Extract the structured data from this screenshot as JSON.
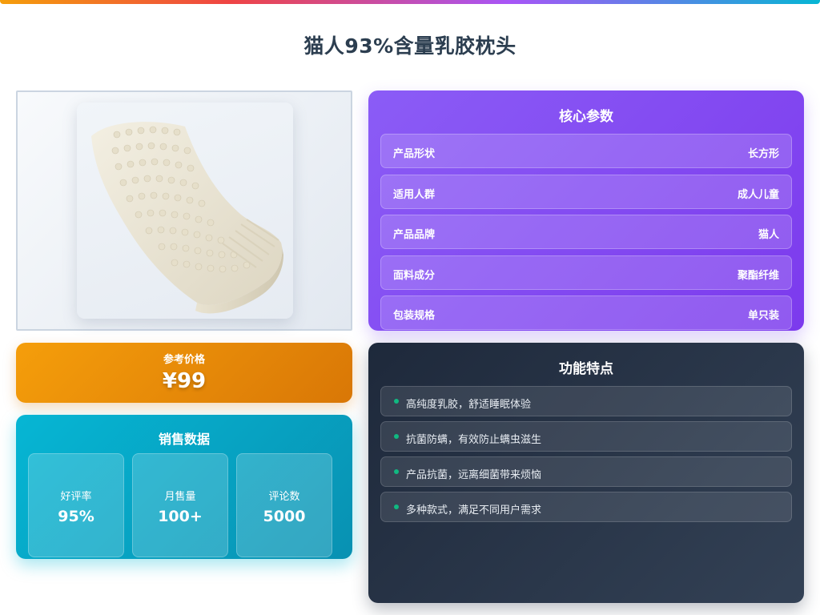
{
  "page": {
    "title": "猫人93%含量乳胶枕头"
  },
  "price": {
    "label": "参考价格",
    "value": "¥99"
  },
  "sales": {
    "title": "销售数据",
    "stats": [
      {
        "label": "好评率",
        "value": "95%"
      },
      {
        "label": "月售量",
        "value": "100+"
      },
      {
        "label": "评论数",
        "value": "5000"
      }
    ]
  },
  "specs": {
    "title": "核心参数",
    "rows": [
      {
        "key": "产品形状",
        "value": "长方形"
      },
      {
        "key": "适用人群",
        "value": "成人儿童"
      },
      {
        "key": "产品品牌",
        "value": "猫人"
      },
      {
        "key": "面料成分",
        "value": "聚酯纤维"
      },
      {
        "key": "包装规格",
        "value": "单只装"
      }
    ]
  },
  "features": {
    "title": "功能特点",
    "items": [
      "高纯度乳胶，舒适睡眠体验",
      "抗菌防螨，有效防止螨虫滋生",
      "产品抗菌，远离细菌带来烦恼",
      "多种款式，满足不同用户需求"
    ]
  },
  "colors": {
    "price_gradient": [
      "#f59e0b",
      "#d97706"
    ],
    "sales_gradient": [
      "#06b6d4",
      "#0891b2"
    ],
    "specs_gradient": [
      "#8b5cf6",
      "#7c3aed"
    ],
    "features_gradient": [
      "#1e293b",
      "#334155"
    ],
    "feature_dot": "#10b981"
  },
  "icons": {
    "feature_bullet": "dot-icon"
  }
}
